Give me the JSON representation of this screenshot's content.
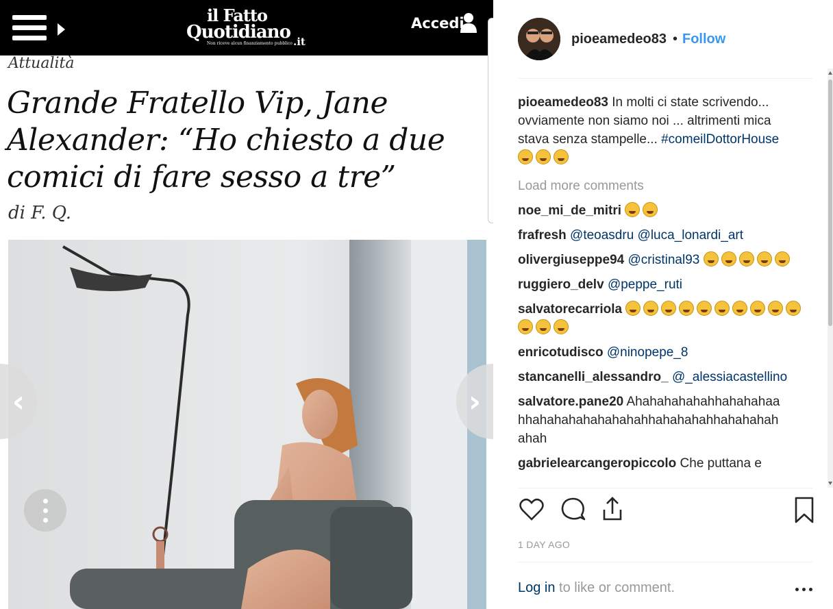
{
  "article": {
    "header": {
      "logo_line1": "il Fatto",
      "logo_line2": "Quotidiano",
      "logo_tld": ".it",
      "logo_tagline": "Non riceve alcun finanziamento pubblico",
      "accedi_label": "Accedi"
    },
    "section": "Attualità",
    "headline": "Grande Fratello Vip, Jane Alexander: “Ho chiesto a due comici di fare sesso a tre”",
    "byline": "di F. Q."
  },
  "carousel": {
    "prev_glyph": "‹",
    "next_glyph": "›"
  },
  "post": {
    "username": "pioeamedeo83",
    "dot": "•",
    "follow_label": "Follow",
    "caption": {
      "username": "pioeamedeo83",
      "text": "In molti ci state scrivendo... ovviamente non siamo noi ... altrimenti mica stava senza stampelle... ",
      "hashtag": "#comeilDottorHouse",
      "emoji_count": 3
    },
    "load_more": "Load more comments",
    "comments": [
      {
        "user": "noe_mi_de_mitri",
        "text": "",
        "mentions": [],
        "emoji_count": 2
      },
      {
        "user": "frafresh",
        "text": "",
        "mentions": [
          "@teoasdru",
          "@luca_lonardi_art"
        ],
        "emoji_count": 0
      },
      {
        "user": "olivergiuseppe94",
        "text": "",
        "mentions": [
          "@cristinal93"
        ],
        "emoji_count": 5
      },
      {
        "user": "ruggiero_delv",
        "text": "",
        "mentions": [
          "@peppe_ruti"
        ],
        "emoji_count": 0
      },
      {
        "user": "salvatorecarriola",
        "text": "",
        "mentions": [],
        "emoji_count": 13
      },
      {
        "user": "enricotudisco",
        "text": "",
        "mentions": [
          "@ninopepe_8"
        ],
        "emoji_count": 0
      },
      {
        "user": "stancanelli_alessandro_",
        "text": "",
        "mentions": [
          "@_alessiacastellino"
        ],
        "emoji_count": 0
      },
      {
        "user": "salvatore.pane20",
        "text": "Ahahahahahahhahahahaa hhahahahahahahahahhahahahahhahahahah ahah",
        "mentions": [],
        "emoji_count": 0
      },
      {
        "user": "gabrielearcangeropiccolo",
        "text": "Che puttana e",
        "mentions": [],
        "emoji_count": 0
      }
    ],
    "date": "1 DAY AGO",
    "login_link": "Log in",
    "login_rest": " to like or comment."
  },
  "icons": {
    "like": "heart-icon",
    "comment": "comment-icon",
    "share": "share-icon",
    "save": "bookmark-icon",
    "more": "more-options-icon"
  },
  "colors": {
    "link_blue": "#3897f0",
    "mention_blue": "#003569",
    "muted_gray": "#999999",
    "text_dark": "#262626",
    "newspaper_header": "#000000"
  }
}
